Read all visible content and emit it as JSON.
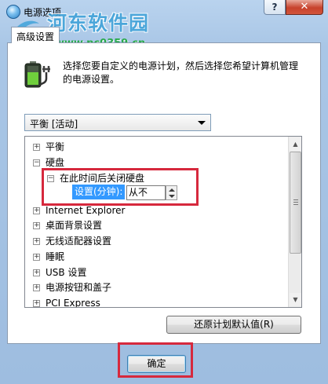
{
  "window": {
    "title": "电源选项",
    "help_label": "?",
    "close_label": "✕"
  },
  "watermark": {
    "brand": "河东软件园",
    "url": "www.pc0359.cn"
  },
  "tabs": [
    {
      "label": "高级设置"
    }
  ],
  "description": "选择您要自定义的电源计划，然后选择您希望计算机管理的电源设置。",
  "plan_select": {
    "value": "平衡 [活动]"
  },
  "tree": {
    "items": [
      {
        "label": "平衡",
        "expander": "+"
      },
      {
        "label": "硬盘",
        "expander": "−"
      },
      {
        "label": "在此时间后关闭硬盘",
        "expander": "−"
      },
      {
        "label": "Internet Explorer",
        "expander": "+"
      },
      {
        "label": "桌面背景设置",
        "expander": "+"
      },
      {
        "label": "无线适配器设置",
        "expander": "+"
      },
      {
        "label": "睡眠",
        "expander": "+"
      },
      {
        "label": "USB 设置",
        "expander": "+"
      },
      {
        "label": "电源按钮和盖子",
        "expander": "+"
      },
      {
        "label": "PCI Express",
        "expander": "+"
      }
    ],
    "setting": {
      "label": "设置(分钟):",
      "value": "从不"
    }
  },
  "buttons": {
    "restore": "还原计划默认值(R)",
    "ok": "确定"
  },
  "colors": {
    "highlight": "#3399ff",
    "annotation": "#d6293d",
    "watermark_brand": "#3aa0d8",
    "watermark_url": "#27a84a"
  },
  "icons": {
    "title": "power-options-icon",
    "battery": "battery-plug-icon",
    "dropdown": "chevron-down-icon"
  }
}
